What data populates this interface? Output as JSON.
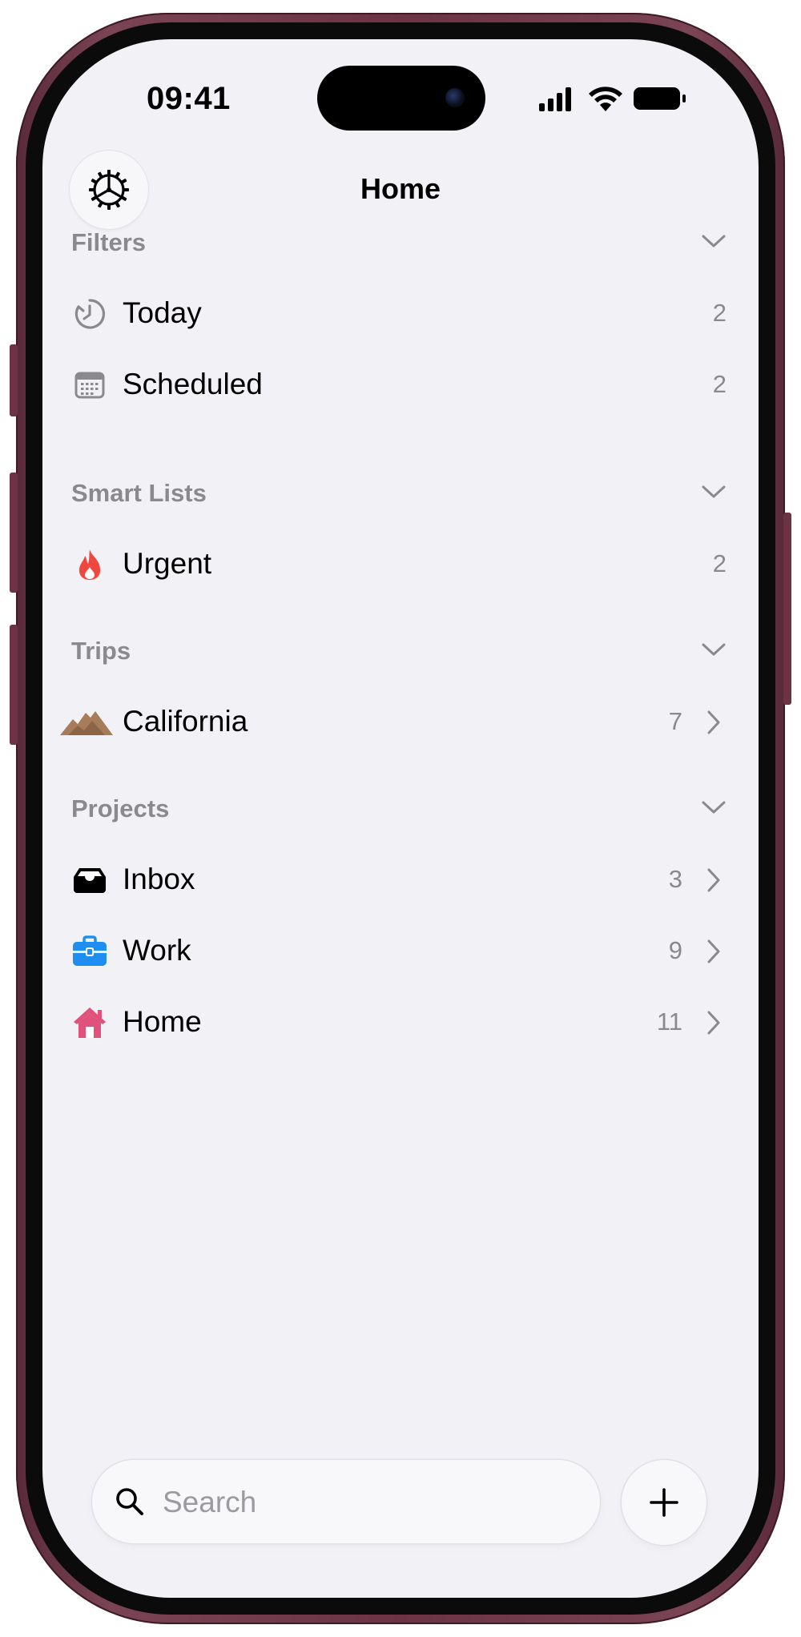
{
  "status_bar": {
    "time": "09:41"
  },
  "header": {
    "title": "Home",
    "settings_icon": "gear-icon"
  },
  "sections": [
    {
      "label": "Filters",
      "items": [
        {
          "label": "Today",
          "count": "2",
          "icon": "clock-icon",
          "chevron": false
        },
        {
          "label": "Scheduled",
          "count": "2",
          "icon": "calendar-icon",
          "chevron": false
        }
      ]
    },
    {
      "label": "Smart Lists",
      "items": [
        {
          "label": "Urgent",
          "count": "2",
          "icon": "flame-icon",
          "chevron": false
        }
      ]
    },
    {
      "label": "Trips",
      "items": [
        {
          "label": "California",
          "count": "7",
          "icon": "mountains-icon",
          "chevron": true
        }
      ]
    },
    {
      "label": "Projects",
      "items": [
        {
          "label": "Inbox",
          "count": "3",
          "icon": "tray-icon",
          "chevron": true
        },
        {
          "label": "Work",
          "count": "9",
          "icon": "briefcase-icon",
          "chevron": true
        },
        {
          "label": "Home",
          "count": "11",
          "icon": "house-icon",
          "chevron": true
        }
      ]
    }
  ],
  "bottom_bar": {
    "search_placeholder": "Search",
    "add_icon": "plus-icon"
  },
  "colors": {
    "background": "#f2f1f6",
    "secondary_text": "#8a8a8e",
    "frame": "#6b3344",
    "flame": "#f0473e",
    "mountains": "#a67c5b",
    "briefcase": "#1e8ff0",
    "house": "#e0527a"
  }
}
